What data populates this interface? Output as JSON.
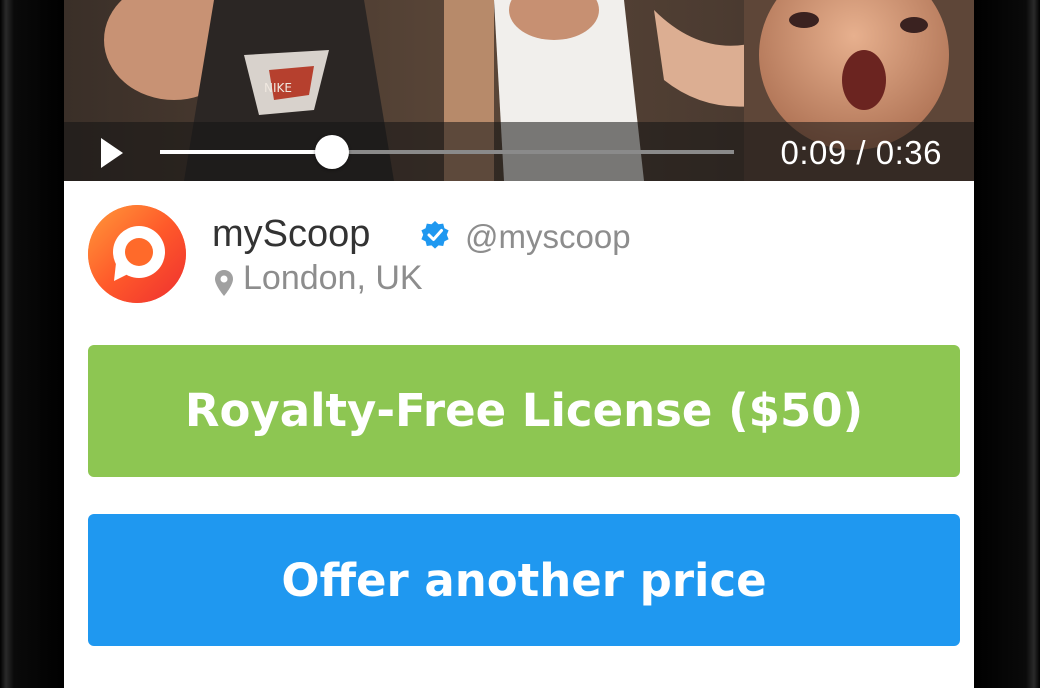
{
  "video": {
    "current_time": "0:09",
    "duration": "0:36",
    "time_display": "0:09 / 0:36",
    "progress_fraction": 0.3
  },
  "profile": {
    "name": "myScoop",
    "handle": "@myscoop",
    "location": "London, UK",
    "verified": true
  },
  "actions": {
    "license_label": "Royalty-Free License ($50)",
    "offer_label": "Offer another price"
  },
  "colors": {
    "license_button": "#8dc652",
    "offer_button": "#1f98f0",
    "verified_badge": "#1f98f0",
    "avatar_brand": "#ff5a28"
  },
  "icons": {
    "play": "play-icon",
    "verified": "verified-badge-icon",
    "location": "location-pin-icon"
  }
}
